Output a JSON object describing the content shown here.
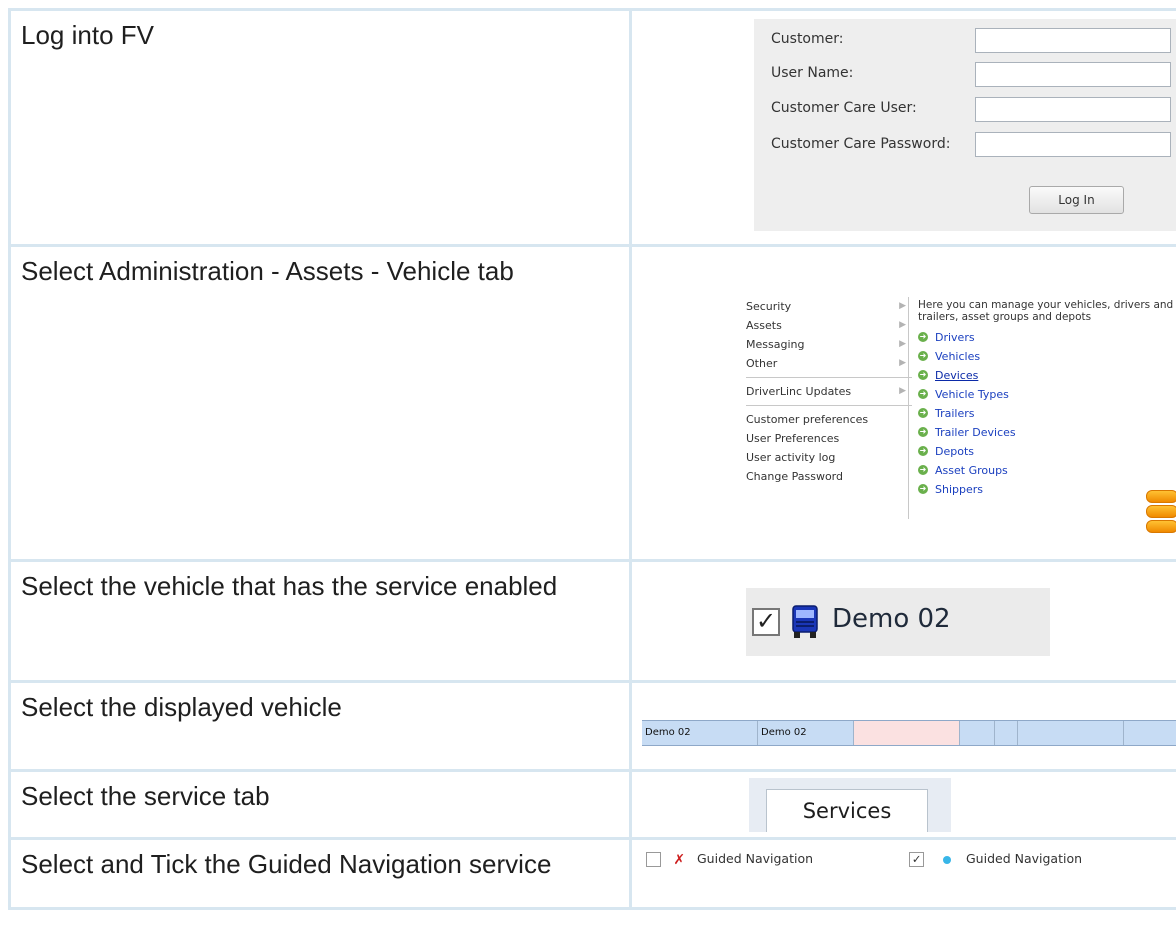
{
  "steps": [
    {
      "text": "Log into FV"
    },
    {
      "text": "Select Administration - Assets - Vehicle tab"
    },
    {
      "text": "Select the vehicle that has the service enabled"
    },
    {
      "text": "Select the displayed vehicle"
    },
    {
      "text": "Select the service tab"
    },
    {
      "text": "Select and Tick the Guided Navigation service"
    }
  ],
  "login": {
    "customer_label": "Customer:",
    "username_label": "User Name:",
    "cc_user_label": "Customer Care User:",
    "cc_password_label": "Customer Care Password:",
    "login_button": "Log In"
  },
  "admin": {
    "menu": [
      "Security",
      "Assets",
      "Messaging",
      "Other",
      "DriverLinc Updates",
      "Customer preferences",
      "User Preferences",
      "User activity log",
      "Change Password"
    ],
    "intro": "Here you can manage your vehicles, drivers and trailers, asset groups and depots",
    "links": [
      "Drivers",
      "Vehicles",
      "Devices",
      "Vehicle Types",
      "Trailers",
      "Trailer Devices",
      "Depots",
      "Asset Groups",
      "Shippers"
    ]
  },
  "vehicle": {
    "name": "Demo 02",
    "checked": true,
    "icon": "truck-icon"
  },
  "grid_row": {
    "cells": [
      "Demo 02",
      "Demo 02",
      "",
      "",
      "",
      "",
      ""
    ]
  },
  "services_tab": {
    "label": "Services"
  },
  "guided": {
    "unticked_label": "Guided Navigation",
    "ticked_label": "Guided Navigation",
    "colors": {
      "cross": "#cc1b1b",
      "dot": "#38b6e8"
    }
  }
}
